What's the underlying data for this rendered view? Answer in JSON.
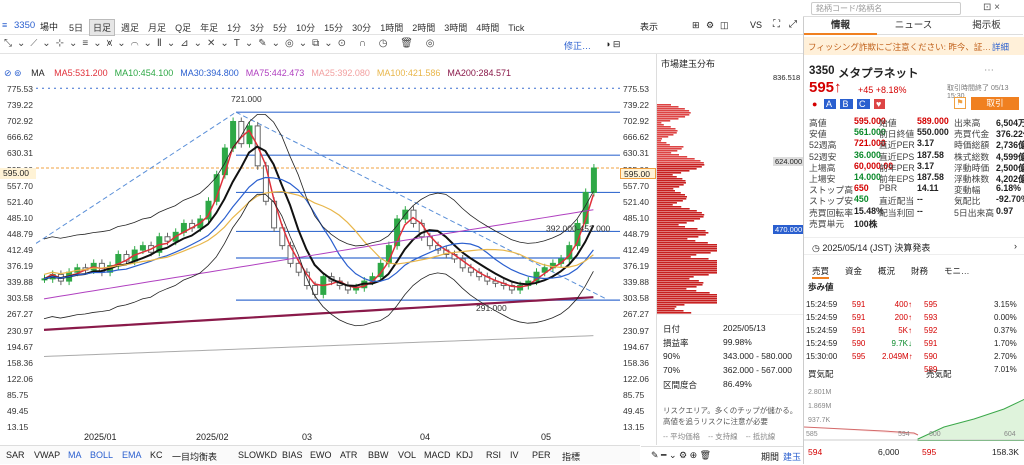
{
  "header": {
    "symbol": "3350",
    "search_placeholder": "銘柄コード/銘柄名",
    "market": "場中",
    "timeframes": [
      "5日",
      "日足",
      "週足",
      "月足",
      "Q足",
      "年足",
      "1分",
      "3分",
      "5分",
      "10分",
      "15分",
      "30分",
      "1時間",
      "2時間",
      "3時間",
      "4時間",
      "Tick"
    ],
    "active_tf": "日足",
    "display_label": "表示",
    "vs_label": "VS",
    "modify_label": "修正…"
  },
  "legend": {
    "ma": "MA",
    "items": [
      {
        "t": "MA5:531.200",
        "c": "#e0303a"
      },
      {
        "t": "MA10:454.100",
        "c": "#2ea846"
      },
      {
        "t": "MA30:394.800",
        "c": "#2a5fcf"
      },
      {
        "t": "MA75:442.473",
        "c": "#b040c0"
      },
      {
        "t": "MA25:392.080",
        "c": "#f2a0a0"
      },
      {
        "t": "MA100:421.586",
        "c": "#e8b64a"
      },
      {
        "t": "MA200:284.571",
        "c": "#8a1a4a"
      }
    ]
  },
  "axis": {
    "left": [
      "775.53",
      "739.22",
      "702.92",
      "666.62",
      "630.31",
      "595.00",
      "557.70",
      "521.40",
      "485.10",
      "448.79",
      "412.49",
      "376.19",
      "339.88",
      "303.58",
      "267.27",
      "230.97",
      "194.67",
      "158.36",
      "122.06",
      "85.75",
      "49.45",
      "13.15"
    ],
    "right": [
      "775.53",
      "739.22",
      "702.92",
      "666.62",
      "630.31",
      "595.00",
      "557.70",
      "521.40",
      "485.10",
      "448.79",
      "412.49",
      "376.19",
      "339.88",
      "303.58",
      "267.27",
      "230.97",
      "194.67",
      "158.36",
      "122.06",
      "85.75",
      "49.45",
      "13.15"
    ],
    "months": [
      "2025/01",
      "2025/02",
      "03",
      "04",
      "05"
    ],
    "current": "595.00"
  },
  "annotations": {
    "high": "721.000",
    "low": "291.000",
    "range": "392.000-452.000"
  },
  "indicators": [
    "SAR",
    "VWAP",
    "MA",
    "BOLL",
    "EMA",
    "KC",
    "一目均衡表",
    "SLOWKD",
    "BIAS",
    "EWO",
    "ATR",
    "BBW",
    "VOL",
    "MACD",
    "KDJ",
    "RSI",
    "IV",
    "PER",
    "指標"
  ],
  "market_profile": {
    "title": "市場建玉分布",
    "top": "836.518",
    "p1": "624.000",
    "p2": "470.000",
    "date_label": "日付",
    "date": "2025/05/13",
    "rows": [
      {
        "k": "損益率",
        "v": "99.98%"
      },
      {
        "k": "90%",
        "v": "343.000 - 580.000"
      },
      {
        "k": "70%",
        "v": "362.000 - 567.000"
      },
      {
        "k": "区間度合",
        "v": "86.49%"
      }
    ],
    "note": "リスクエリア。多くのチップが儲かる。高値を追うリスクに注意が必要",
    "legend": [
      "平均価格",
      "支持線",
      "抵抗線"
    ],
    "period_label": "期間",
    "period_val": "建玉"
  },
  "panel": {
    "tabs": [
      "情報",
      "ニュース",
      "掲示板"
    ],
    "alert": "フィッシング詐欺にご注意ください: 昨今、証…",
    "alert_link": "詳細",
    "code": "3350",
    "name": "メタプラネット",
    "price": "595",
    "change": "+45 +8.18%",
    "time": "取引時間終了 05/13 15:30",
    "trade_label": "取引",
    "stats": [
      [
        "高値",
        "595.000",
        "始値",
        "589.000",
        "出来高",
        "6,504万"
      ],
      [
        "安値",
        "561.000",
        "前日終値",
        "550.000",
        "売買代金",
        "376.22億"
      ],
      [
        "52週高",
        "721.000",
        "直近PER",
        "3.17",
        "時価総額",
        "2,736億"
      ],
      [
        "52週安",
        "36.000",
        "直近EPS",
        "187.58",
        "株式総数",
        "4,599億"
      ],
      [
        "上場高",
        "60,000.00",
        "前年PER",
        "3.17",
        "浮動時価",
        "2,500億"
      ],
      [
        "上場安",
        "14.000",
        "前年EPS",
        "187.58",
        "浮動株数",
        "4,202億"
      ],
      [
        "ストップ高",
        "650",
        "PBR",
        "14.11",
        "変動幅",
        "6.18%"
      ],
      [
        "ストップ安",
        "450",
        "直近配当",
        "--",
        "気配比",
        "-92.70%"
      ],
      [
        "売買回転率",
        "15.48%",
        "配当利回",
        "--",
        "5日出来高",
        "0.97"
      ],
      [
        "売買単元",
        "100株",
        "",
        "",
        "",
        ""
      ]
    ],
    "event": "2025/05/14 (JST)  決算発表",
    "subtabs": [
      "売買",
      "資金",
      "概況",
      "財務",
      "モニ…"
    ],
    "ticks_title": "歩み値",
    "ticks": [
      [
        "15:24:59",
        "591",
        "400"
      ],
      [
        "15:24:59",
        "591",
        "200"
      ],
      [
        "15:24:59",
        "591",
        "5K"
      ],
      [
        "15:24:59",
        "590",
        "9.7K"
      ],
      [
        "15:30:00",
        "595",
        "2.049M"
      ]
    ],
    "book": [
      [
        "595",
        "3.15%"
      ],
      [
        "593",
        "0.00%"
      ],
      [
        "592",
        "0.37%"
      ],
      [
        "591",
        "1.70%"
      ],
      [
        "590",
        "2.70%"
      ],
      [
        "589",
        "7.01%"
      ]
    ],
    "buy_label": "買気配",
    "sell_label": "売気配",
    "vols": [
      "2.801M",
      "1.869M",
      "937.7K"
    ],
    "lows": [
      "585",
      "594",
      "600",
      "604"
    ],
    "bottom": [
      [
        "594",
        "6,000"
      ],
      [
        "595",
        "158.3K"
      ]
    ]
  }
}
